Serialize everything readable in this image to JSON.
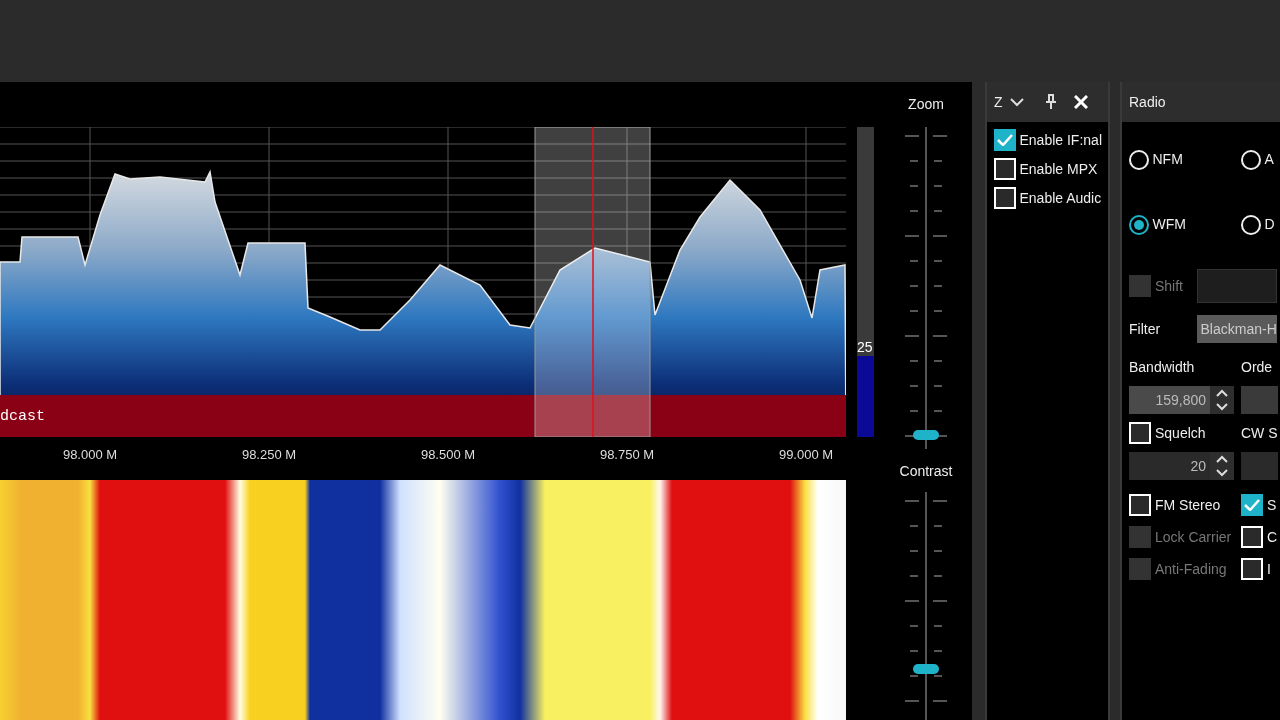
{
  "spectrum": {
    "band_label": "dcast",
    "frequency_labels": [
      "98.000 M",
      "98.250 M",
      "98.500 M",
      "98.750 M",
      "99.000 M"
    ],
    "meter": {
      "level": 0.26,
      "reading": "25"
    }
  },
  "zoom_slider": {
    "label": "Zoom",
    "level": 0
  },
  "contrast_slider": {
    "label": "Contrast",
    "level": 0.18
  },
  "side_panel": {
    "title": "Z",
    "checkboxes": [
      {
        "label": "Enable IF:nal",
        "checked": true
      },
      {
        "label": "Enable MPX",
        "checked": false
      },
      {
        "label": "Enable Audic",
        "checked": false
      }
    ]
  },
  "radio_panel": {
    "title": "Radio",
    "modes": [
      {
        "label": "NFM",
        "selected": false
      },
      {
        "label": "A",
        "selected": false
      },
      {
        "label": "WFM",
        "selected": true
      },
      {
        "label": "D",
        "selected": false
      }
    ],
    "shift": {
      "label": "Shift",
      "checked": false,
      "disabled": true
    },
    "filter": {
      "label": "Filter",
      "value": "Blackman-H"
    },
    "bandwidth": {
      "label": "Bandwidth",
      "value": "159,800"
    },
    "order": {
      "label": "Orde"
    },
    "squelch": {
      "label": "Squelch",
      "checked": false,
      "disabled": false
    },
    "cw": {
      "label": "CW S"
    },
    "squelch_level": {
      "value": "20"
    },
    "options": [
      {
        "label": "FM Stereo",
        "checked": false,
        "disabled": false
      },
      {
        "label": "S",
        "checked": true,
        "disabled": false
      },
      {
        "label": "Lock Carrier",
        "checked": false,
        "disabled": true
      },
      {
        "label": "C",
        "checked": false,
        "disabled": false
      },
      {
        "label": "Anti-Fading",
        "checked": false,
        "disabled": true
      },
      {
        "label": "I",
        "checked": false,
        "disabled": false
      }
    ]
  }
}
